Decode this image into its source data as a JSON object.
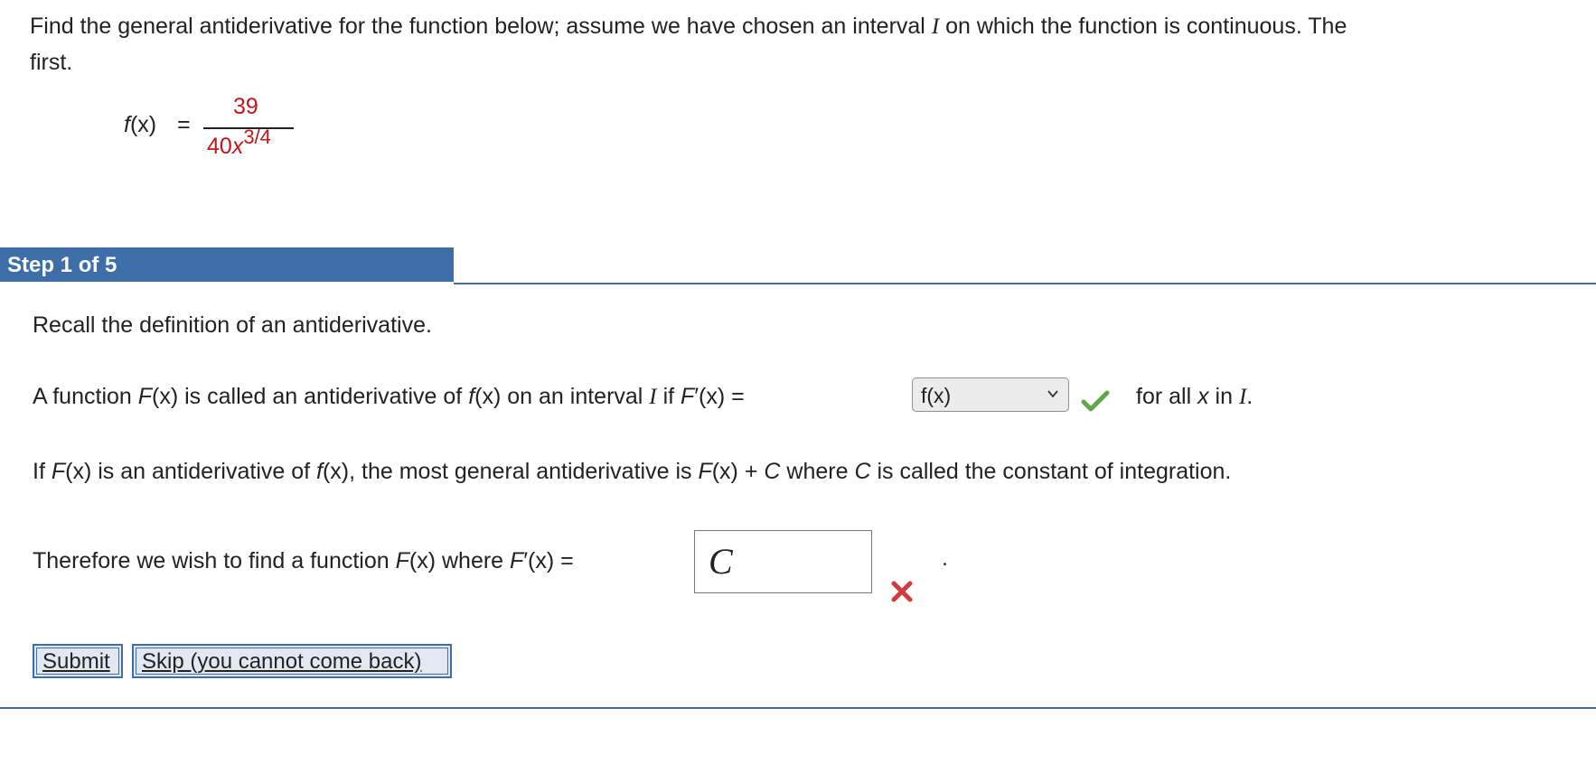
{
  "problem": {
    "line1_a": "Find the general antiderivative for the function below; assume we have chosen an interval ",
    "line1_var": "I",
    "line1_b": " on which the function is continuous. The",
    "line2": "first.",
    "fx_label_f": "f",
    "fx_label_rest": "(x)",
    "equals": "=",
    "numerator": "39",
    "denominator_base": "40",
    "denominator_var": "x",
    "denominator_exp": "3/4"
  },
  "step": {
    "label": "Step 1 of 5",
    "recall": "Recall the definition of an antiderivative.",
    "def_a": "A function ",
    "def_F": "F",
    "def_b": "(x) is called an antiderivative of ",
    "def_f": "f",
    "def_c": "(x) on an interval ",
    "def_I": "I",
    "def_d": " if ",
    "def_Fp": "F",
    "def_e": "′(x) =",
    "dropdown_value": "f(x)",
    "def_tail_a": "for all ",
    "def_tail_x": "x",
    "def_tail_b": " in ",
    "def_tail_I": "I",
    "def_tail_c": ".",
    "gen_a": "If ",
    "gen_F": "F",
    "gen_b": "(x) is an antiderivative of ",
    "gen_f": "f",
    "gen_c": "(x), the most general antiderivative is ",
    "gen_F2": "F",
    "gen_d": "(x) + ",
    "gen_C": "C",
    "gen_e": " where ",
    "gen_C2": "C",
    "gen_f2": " is called the constant of integration.",
    "there_a": "Therefore we wish to find a function ",
    "there_F": "F",
    "there_b": "(x) where ",
    "there_Fp": "F",
    "there_c": "′(x) =",
    "answer_value": "C",
    "period": "."
  },
  "buttons": {
    "submit": "Submit",
    "skip": "Skip (you cannot come back)"
  },
  "colors": {
    "accent": "#3e6ea8",
    "highlight_red": "#c0171c",
    "check_green": "#5fa84a",
    "error_red": "#d23b3b"
  },
  "icons": {
    "correct": "check-icon",
    "incorrect": "x-icon",
    "dropdown": "chevron-down-icon"
  }
}
